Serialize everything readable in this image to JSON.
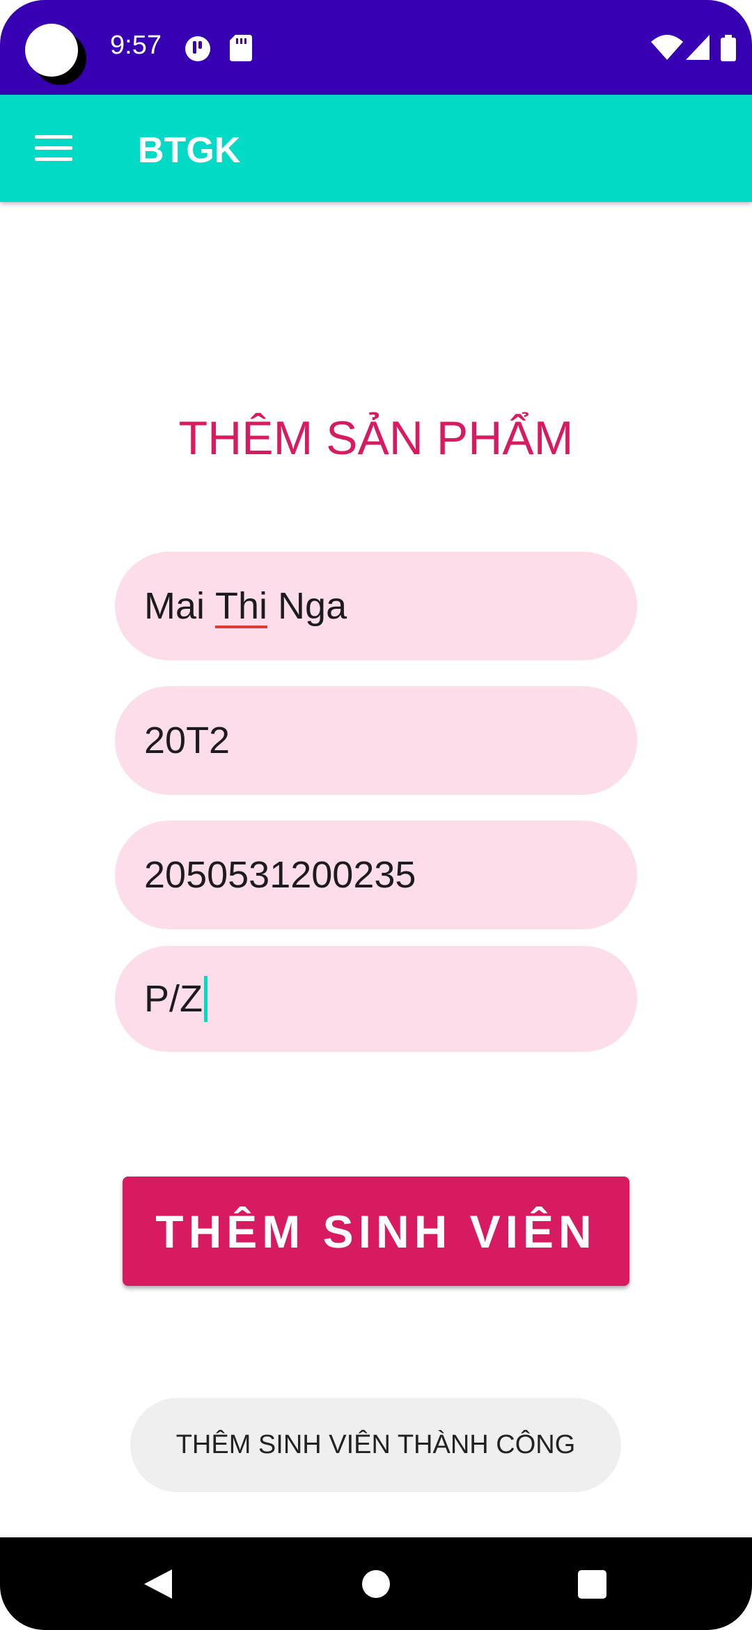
{
  "status_bar": {
    "time": "9:57",
    "icons": [
      "camera-cutout",
      "notification-app-icon",
      "sd-card-icon",
      "wifi-icon",
      "cell-signal-icon",
      "battery-icon"
    ]
  },
  "app_bar": {
    "title": "BTGK",
    "menu_icon": "hamburger-menu-icon",
    "background": "#03dac5"
  },
  "form": {
    "heading": "THÊM SẢN PHẨM",
    "name_first": "Mai ",
    "name_misspelled": "Thi",
    "name_last": " Nga",
    "class_value": "20T2",
    "student_id_value": "2050531200235",
    "fourth_field_value": "P/Z",
    "submit_label": "THÊM SINH VIÊN"
  },
  "toast": {
    "message": "THÊM SINH VIÊN THÀNH CÔNG"
  },
  "nav_bar": {
    "icons": [
      "back-icon",
      "home-icon",
      "recents-icon"
    ]
  },
  "colors": {
    "status_bar": "#3700b3",
    "accent": "#d81b60",
    "field_bg": "#fddde9",
    "cursor": "#03dac5"
  }
}
